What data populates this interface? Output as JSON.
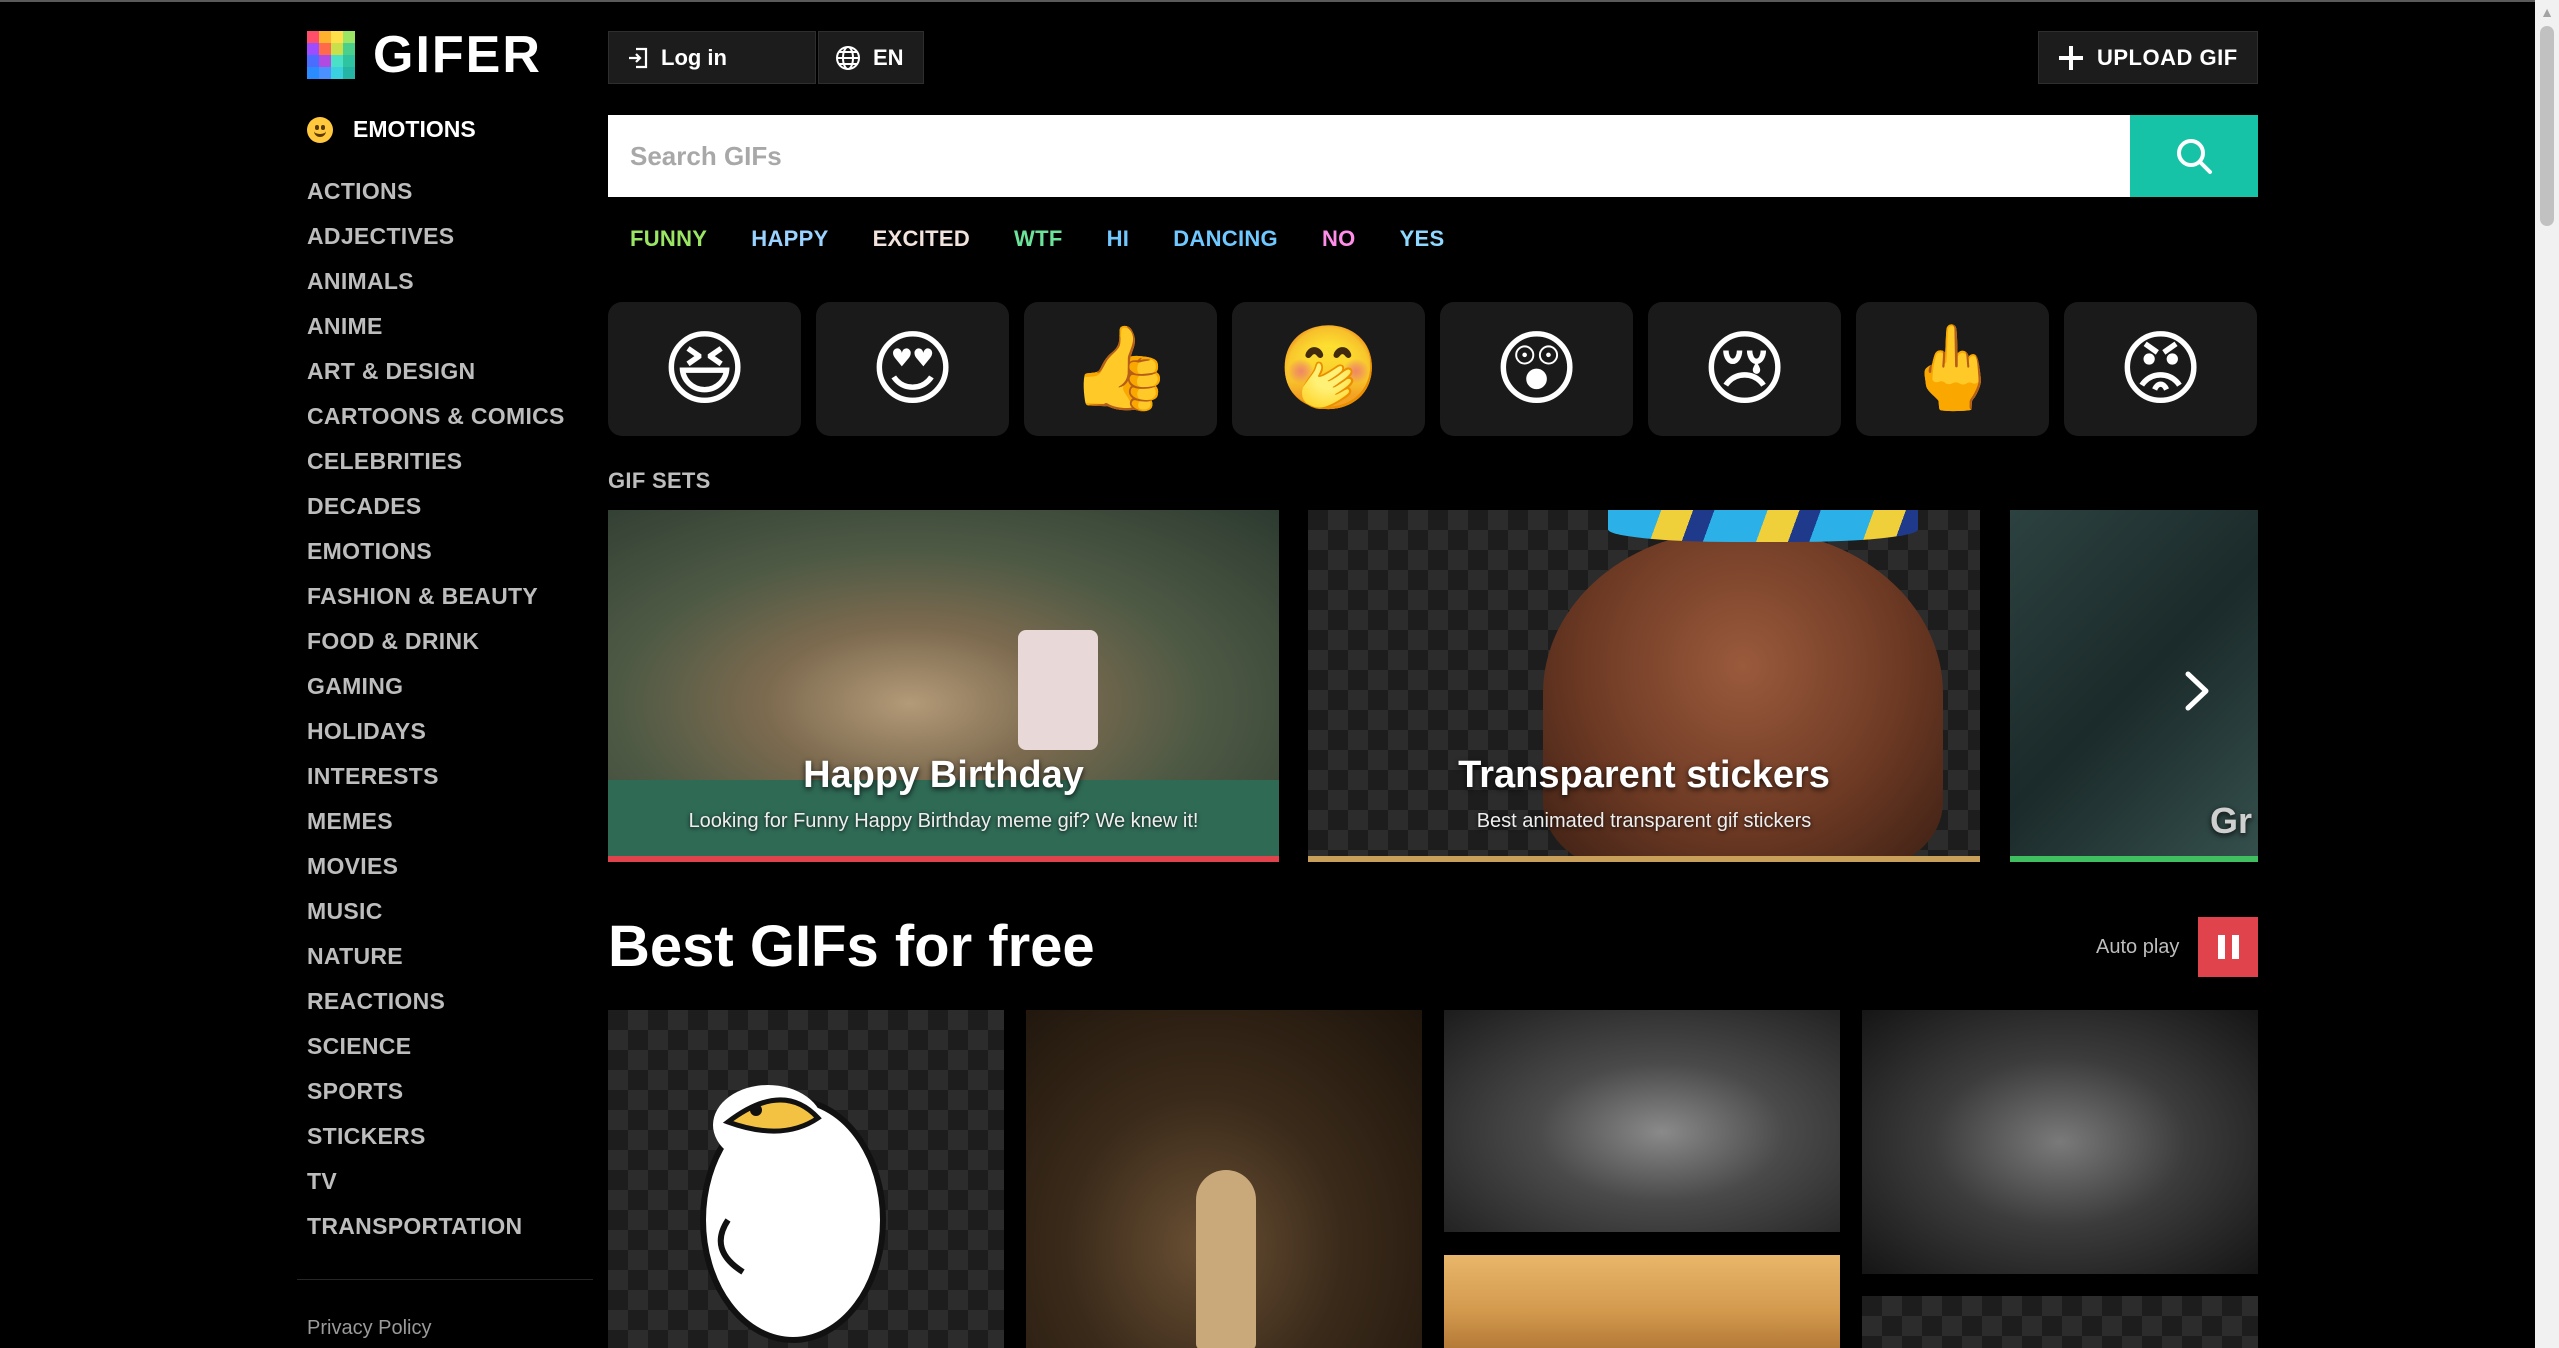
{
  "brand": {
    "name": "GIFER"
  },
  "sidebar": {
    "featured": "EMOTIONS",
    "categories": [
      "ACTIONS",
      "ADJECTIVES",
      "ANIMALS",
      "ANIME",
      "ART & DESIGN",
      "CARTOONS & COMICS",
      "CELEBRITIES",
      "DECADES",
      "EMOTIONS",
      "FASHION & BEAUTY",
      "FOOD & DRINK",
      "GAMING",
      "HOLIDAYS",
      "INTERESTS",
      "MEMES",
      "MOVIES",
      "MUSIC",
      "NATURE",
      "REACTIONS",
      "SCIENCE",
      "SPORTS",
      "STICKERS",
      "TV",
      "TRANSPORTATION"
    ],
    "privacy": "Privacy Policy"
  },
  "header": {
    "login_label": "Log in",
    "lang_label": "EN",
    "upload_label": "UPLOAD GIF"
  },
  "search": {
    "placeholder": "Search GIFs"
  },
  "tags": [
    {
      "label": "FUNNY",
      "color": "#9be564"
    },
    {
      "label": "HAPPY",
      "color": "#9ad3ff"
    },
    {
      "label": "EXCITED",
      "color": "#f2e4dc"
    },
    {
      "label": "WTF",
      "color": "#6be39b"
    },
    {
      "label": "HI",
      "color": "#72c7ff"
    },
    {
      "label": "DANCING",
      "color": "#6fc8ff"
    },
    {
      "label": "NO",
      "color": "#ff8ee8"
    },
    {
      "label": "YES",
      "color": "#8fd8ff"
    }
  ],
  "reactions": [
    "😆",
    "😍",
    "👍",
    "🤭",
    "😲",
    "😢",
    "🖕",
    "😡"
  ],
  "gif_sets": {
    "label": "GIF SETS",
    "items": [
      {
        "title": "Happy Birthday",
        "desc": "Looking for Funny Happy Birthday meme gif? We knew it!",
        "accent": "#e0434b"
      },
      {
        "title": "Transparent stickers",
        "desc": "Best animated transparent gif stickers",
        "accent": "#c9a05a"
      },
      {
        "title": "Gr",
        "desc": "",
        "accent": "#3fbf5f"
      }
    ]
  },
  "main": {
    "title": "Best GIFs for free",
    "autoplay_label": "Auto play"
  },
  "colors": {
    "search_button": "#17c3a6",
    "pause_button": "#e0434b"
  }
}
